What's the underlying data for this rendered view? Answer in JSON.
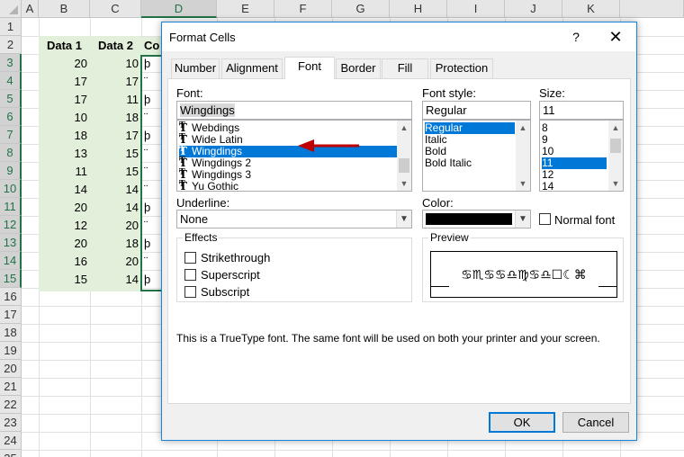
{
  "sheet": {
    "columns": [
      "A",
      "B",
      "C",
      "D",
      "E",
      "F",
      "G",
      "H",
      "I",
      "J",
      "K"
    ],
    "rows": [
      "1",
      "2",
      "3",
      "4",
      "5",
      "6",
      "7",
      "8",
      "9",
      "10",
      "11",
      "12",
      "13",
      "14",
      "15",
      "16",
      "17",
      "18",
      "19",
      "20",
      "21",
      "22",
      "23",
      "24",
      "25"
    ],
    "header_b": "Data 1",
    "header_c": "Data 2",
    "header_d": "Co",
    "data1": [
      "20",
      "17",
      "17",
      "10",
      "18",
      "13",
      "11",
      "14",
      "20",
      "12",
      "20",
      "16",
      "15"
    ],
    "data2": [
      "10",
      "17",
      "11",
      "18",
      "17",
      "15",
      "15",
      "14",
      "14",
      "20",
      "18",
      "20",
      "14"
    ],
    "d_symbols": [
      "þ",
      "¨",
      "þ",
      "¨",
      "þ",
      "¨",
      "¨",
      "¨",
      "þ",
      "¨",
      "þ",
      "¨",
      "þ"
    ]
  },
  "dialog": {
    "title": "Format Cells",
    "help": "?",
    "close": "✕",
    "tabs": [
      "Number",
      "Alignment",
      "Font",
      "Border",
      "Fill",
      "Protection"
    ],
    "font_label": "Font:",
    "font_value": "Wingdings",
    "font_list": [
      "Webdings",
      "Wide Latin",
      "Wingdings",
      "Wingdings 2",
      "Wingdings 3",
      "Yu Gothic"
    ],
    "style_label": "Font style:",
    "style_value": "Regular",
    "style_list": [
      "Regular",
      "Italic",
      "Bold",
      "Bold Italic"
    ],
    "size_label": "Size:",
    "size_value": "11",
    "size_list": [
      "8",
      "9",
      "10",
      "11",
      "12",
      "14"
    ],
    "underline_label": "Underline:",
    "underline_value": "None",
    "color_label": "Color:",
    "color_value_hex": "#000000",
    "normal_font_label": "Normal font",
    "effects_label": "Effects",
    "effects": [
      "Strikethrough",
      "Superscript",
      "Subscript"
    ],
    "preview_label": "Preview",
    "preview_text": "♋♏♋♋♎♍♋♎☐☾⌘",
    "info_text": "This is a TrueType font.  The same font will be used on both your printer and your screen.",
    "ok_label": "OK",
    "cancel_label": "Cancel",
    "accent_color": "#0078d7",
    "arrow_color": "#c00000"
  }
}
